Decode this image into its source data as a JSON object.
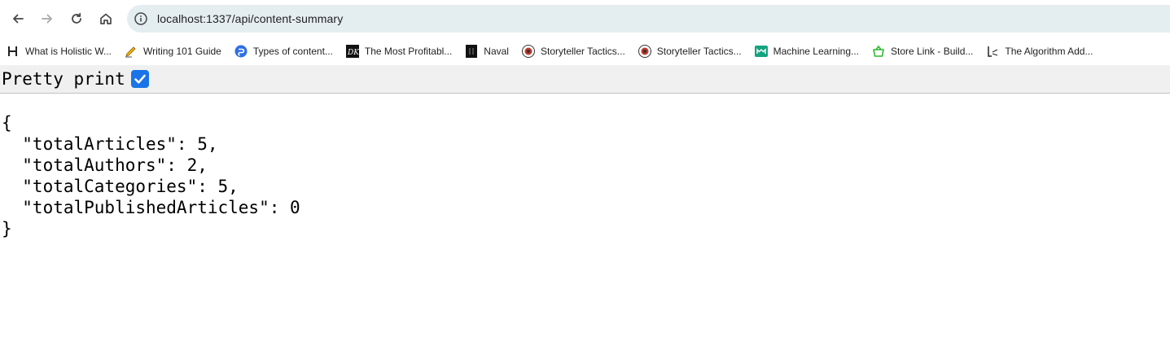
{
  "browser": {
    "url": "localhost:1337/api/content-summary"
  },
  "bookmarks": [
    {
      "label": "What is Holistic W...",
      "icon": "h-letter-icon"
    },
    {
      "label": "Writing 101 Guide",
      "icon": "pencil-icon"
    },
    {
      "label": "Types of content...",
      "icon": "blue-logo-icon"
    },
    {
      "label": "The Most Profitabl...",
      "icon": "dk-logo-icon"
    },
    {
      "label": "Naval",
      "icon": "naval-logo-icon"
    },
    {
      "label": "Storyteller Tactics...",
      "icon": "storyteller-logo-icon"
    },
    {
      "label": "Storyteller Tactics...",
      "icon": "storyteller-logo-icon"
    },
    {
      "label": "Machine Learning...",
      "icon": "green-logo-icon"
    },
    {
      "label": "Store Link - Build...",
      "icon": "basket-icon"
    },
    {
      "label": "The Algorithm Add...",
      "icon": "algorithm-logo-icon"
    }
  ],
  "pretty_print": {
    "label": "Pretty print",
    "checked": true
  },
  "json_text": {
    "open": "{",
    "lines": [
      "  \"totalArticles\": 5,",
      "  \"totalAuthors\": 2,",
      "  \"totalCategories\": 5,",
      "  \"totalPublishedArticles\": 0"
    ],
    "close": "}"
  },
  "colors": {
    "omnibox_bg": "#e4eef1",
    "checkbox_accent": "#1a73e8",
    "toolbar_strip_bg": "#f0f0f0"
  }
}
